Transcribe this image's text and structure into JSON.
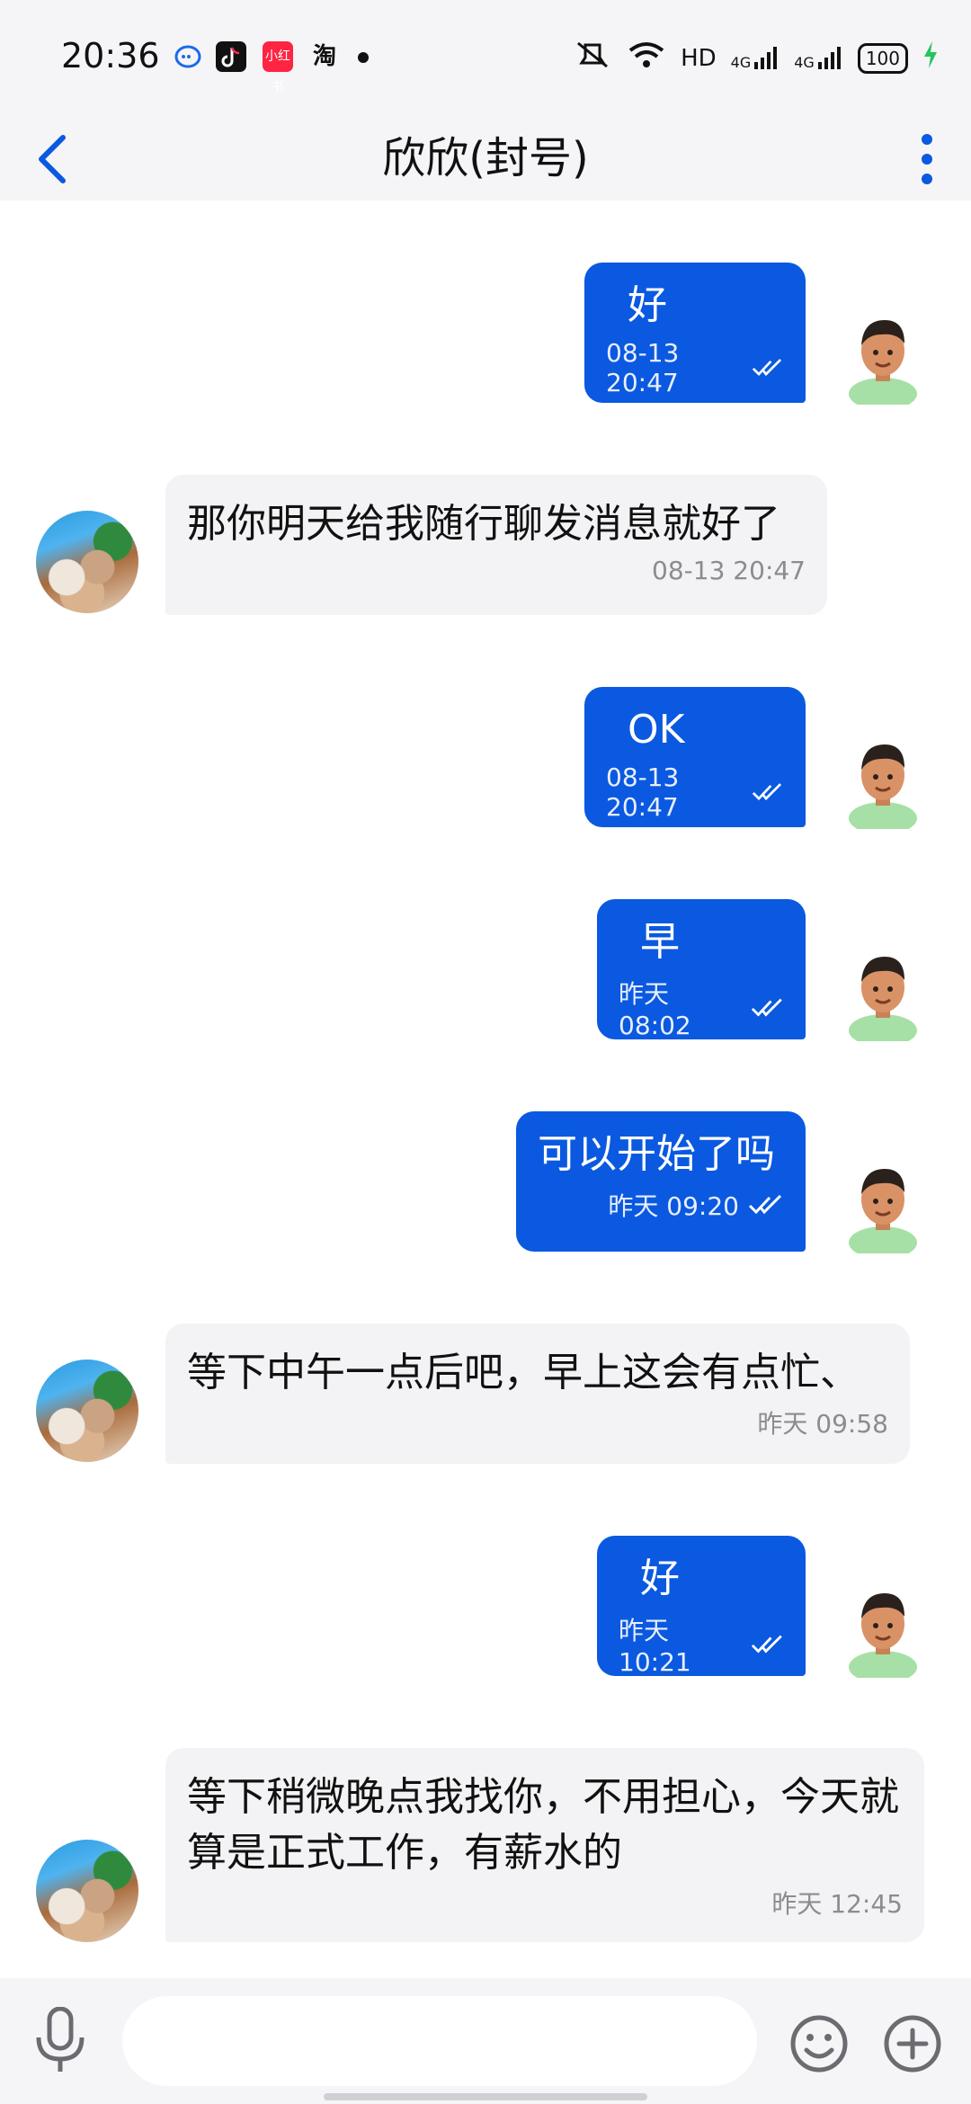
{
  "status_bar": {
    "time": "20:36",
    "app_icons": [
      "message-bubble-icon",
      "tiktok-icon",
      "xiaohongshu-icon",
      "taobao-icon"
    ],
    "app_labels": {
      "xiaohongshu": "小红书",
      "taobao": "淘"
    },
    "network": "HD",
    "signal1": "4G",
    "signal2": "4G",
    "battery": "100"
  },
  "header": {
    "title": "欣欣(封号)"
  },
  "messages": [
    {
      "side": "out",
      "text": "好",
      "time": "08-13 20:47",
      "read": true
    },
    {
      "side": "in",
      "text": "那你明天给我随行聊发消息就好了",
      "time": "08-13 20:47"
    },
    {
      "side": "out",
      "text": "OK",
      "time": "08-13 20:47",
      "read": true
    },
    {
      "side": "out",
      "text": "早",
      "time": "昨天 08:02",
      "read": true
    },
    {
      "side": "out",
      "text": "可以开始了吗",
      "time": "昨天 09:20",
      "read": true
    },
    {
      "side": "in",
      "text": "等下中午一点后吧，早上这会有点忙、",
      "time": "昨天 09:58"
    },
    {
      "side": "out",
      "text": "好",
      "time": "昨天 10:21",
      "read": true
    },
    {
      "side": "in",
      "text": "等下稍微晚点我找你，不用担心，今天就算是正式工作，有薪水的",
      "time": "昨天 12:45"
    }
  ],
  "input": {
    "placeholder": ""
  },
  "colors": {
    "accent": "#0a59e0",
    "bubble_in": "#f3f3f5",
    "bar_bg": "#f5f5f7"
  }
}
